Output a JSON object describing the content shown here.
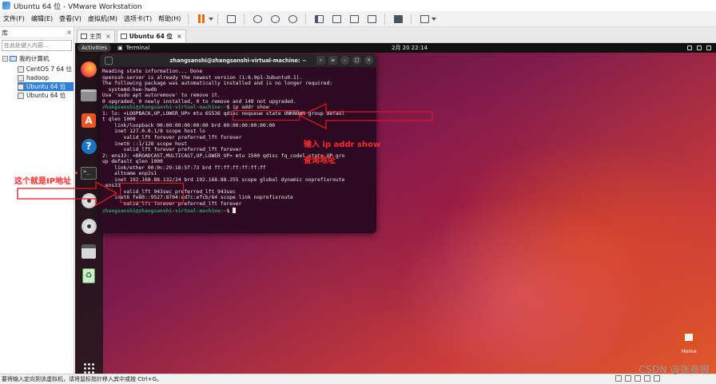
{
  "window": {
    "title": "Ubuntu 64 位 - VMware Workstation"
  },
  "menu": [
    "文件(F)",
    "编辑(E)",
    "查看(V)",
    "虚拟机(M)",
    "选项卡(T)",
    "帮助(H)"
  ],
  "toolbar": {
    "icons": [
      "pause-icon",
      "send-keys-icon",
      "snapshot-icon",
      "revert-snapshot-icon",
      "snapshot-manager-icon",
      "sidebar-toggle-icon",
      "single-window-icon",
      "fullscreen-icon",
      "unity-icon",
      "console-icon",
      "stretch-icon"
    ]
  },
  "library": {
    "title": "库",
    "search_placeholder": "在此处键入内容...",
    "root": "我的计算机",
    "vms": [
      "CentOS 7 64 位",
      "hadoop",
      "Ubuntu 64 位",
      "Ubuntu 64 位"
    ],
    "selected_index": 2
  },
  "tabs": [
    {
      "label": "主页"
    },
    {
      "label": "Ubuntu 64 位",
      "active": true
    }
  ],
  "guest": {
    "activities": "Activities",
    "app_name": "Terminal",
    "clock": "2月 20  22:14",
    "desktop_home_label": "Home"
  },
  "terminal": {
    "title": "zhangsanshi@zhangsanshi-virtual-machine: ~",
    "prompt": "zhangsanshi@zhangsanshi-virtual-machine:~$",
    "lines": [
      {
        "t": "Reading state information... Done"
      },
      {
        "t": "openssh-server is already the newest version (1:8.9p1-3ubuntu0.1)."
      },
      {
        "t": "The following package was automatically installed and is no longer required:"
      },
      {
        "t": "  systemd-hwe-hwdb"
      },
      {
        "t": "Use 'sudo apt autoremove' to remove it."
      },
      {
        "t": "0 upgraded, 0 newly installed, 0 to remove and 148 not upgraded."
      },
      {
        "p": "zhangsanshi@zhangsanshi-virtual-machine:~",
        "t": "$ ip addr show"
      },
      {
        "t": "1: lo: <LOOPBACK,UP,LOWER_UP> mtu 65536 qdisc noqueue state UNKNOWN group defaul"
      },
      {
        "t": "t qlen 1000"
      },
      {
        "t": "    link/loopback 00:00:00:00:00:00 brd 00:00:00:00:00:00"
      },
      {
        "t": "    inet 127.0.0.1/8 scope host lo"
      },
      {
        "t": "       valid_lft forever preferred_lft forever"
      },
      {
        "t": "    inet6 ::1/128 scope host"
      },
      {
        "t": "       valid_lft forever preferred_lft forever"
      },
      {
        "t": "2: ens33: <BROADCAST,MULTICAST,UP,LOWER_UP> mtu 1500 qdisc fq_codel state UP gro"
      },
      {
        "t": "up default qlen 1000"
      },
      {
        "t": "    link/ether 00:0c:29:18:5f:73 brd ff:ff:ff:ff:ff:ff"
      },
      {
        "t": "    altname enp2s1"
      },
      {
        "t": "    inet 192.168.88.132/24 brd 192.168.88.255 scope global dynamic noprefixroute"
      },
      {
        "t": " ens33"
      },
      {
        "t": "       valid_lft 943sec preferred_lft 943sec"
      },
      {
        "t": "    inet6 fe80::9527:8704:ed7c:efcb/64 scope link noprefixroute"
      },
      {
        "t": "       valid_lft forever preferred_lft forever"
      },
      {
        "p": "zhangsanshi@zhangsanshi-virtual-machine:~",
        "t": "$ ",
        "cursor": true
      }
    ]
  },
  "annotations": {
    "command_note_line1": "输入  ip addr  show",
    "command_note_line2": "查询地址",
    "ip_note": "这个就是IP地址"
  },
  "status": {
    "text": "要将输入定向到该虚拟机，请将鼠标指针移入其中或按 Ctrl+G。",
    "watermark": "CSDN @张叁狮"
  },
  "colors": {
    "accent": "#e95420",
    "annotation": "#e2171b",
    "prompt_green": "#26a269"
  }
}
